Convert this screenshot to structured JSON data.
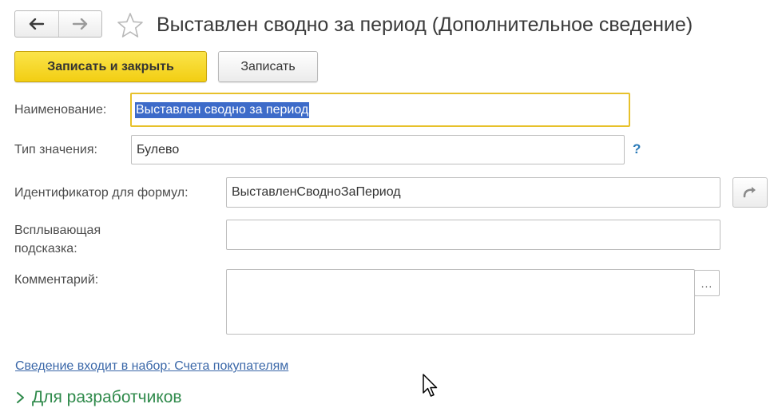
{
  "window": {
    "title": "Выставлен сводно за период (Дополнительное сведение)"
  },
  "nav": {
    "back_icon": "arrow-left-icon",
    "forward_icon": "arrow-right-icon",
    "favorite_icon": "star-icon"
  },
  "toolbar": {
    "save_and_close_label": "Записать и закрыть",
    "save_label": "Записать"
  },
  "form": {
    "name_label": "Наименование:",
    "name_value": "Выставлен сводно за период",
    "type_label": "Тип значения:",
    "type_value": "Булево",
    "type_help": "?",
    "identifier_label": "Идентификатор для формул:",
    "identifier_value": "ВыставленСводноЗаПериод",
    "tooltip_label_line1": "Всплывающая",
    "tooltip_label_line2": "подсказка:",
    "tooltip_value": "",
    "comment_label": "Комментарий:",
    "comment_value": "",
    "comment_more": "..."
  },
  "footer": {
    "set_link": "Сведение входит в набор: Счета покупателям",
    "developers_section": "Для разработчиков"
  },
  "colors": {
    "accent_yellow": "#f2ce13",
    "focus_border": "#e7c12b",
    "selection": "#3d6bc9",
    "link": "#3a67a8",
    "section_green": "#2f8a4b",
    "help_blue": "#2a7ab8"
  }
}
